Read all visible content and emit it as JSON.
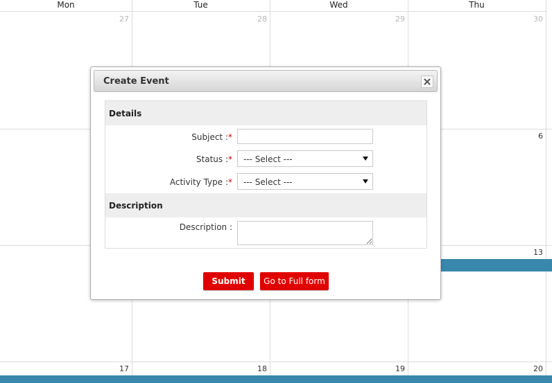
{
  "calendar": {
    "day_headers": [
      "Mon",
      "Tue",
      "Wed",
      "Thu"
    ],
    "weeks": [
      {
        "days": [
          "27",
          "28",
          "29",
          "30"
        ],
        "muted": true
      },
      {
        "days": [
          "",
          "",
          "",
          "6"
        ],
        "muted": false
      },
      {
        "days": [
          "",
          "",
          "",
          "13"
        ],
        "muted": false
      },
      {
        "days": [
          "17",
          "18",
          "19",
          "20"
        ],
        "muted": false
      }
    ],
    "event_color": "#3a87ad"
  },
  "dialog": {
    "title": "Create Event",
    "close_icon": "close-icon",
    "sections": {
      "details_title": "Details",
      "description_title": "Description"
    },
    "fields": {
      "subject_label": "Subject :",
      "subject_value": "",
      "status_label": "Status :",
      "status_selected": "--- Select ---",
      "activity_type_label": "Activity Type :",
      "activity_type_selected": "--- Select ---",
      "description_label": "Description :",
      "description_value": "",
      "required_marker": "*"
    },
    "buttons": {
      "submit": "Submit",
      "full_form": "Go to Full form"
    },
    "button_color": "#e00000"
  }
}
